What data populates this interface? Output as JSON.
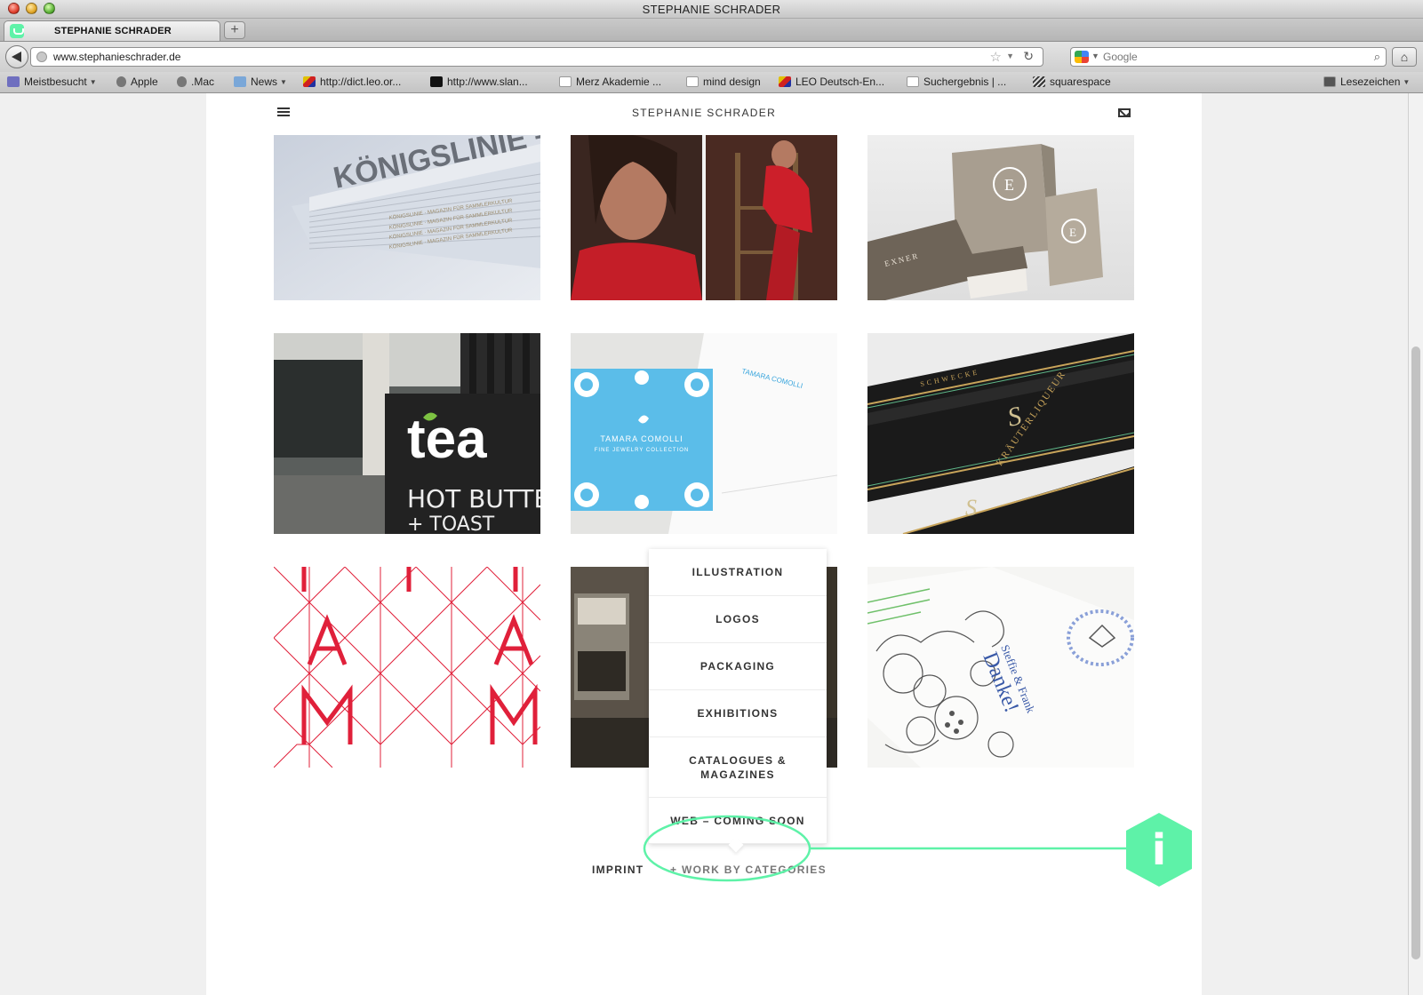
{
  "window": {
    "title": "STEPHANIE SCHRADER"
  },
  "tab": {
    "label": "STEPHANIE SCHRADER",
    "new_tab_symbol": "+"
  },
  "nav": {
    "url": "www.stephanieschrader.de",
    "search_placeholder": "Google"
  },
  "bookmarks": [
    {
      "label": "Meistbesucht",
      "icon": "star-icon",
      "dropdown": true
    },
    {
      "label": "Apple",
      "icon": "apple-icon",
      "dropdown": false
    },
    {
      "label": ".Mac",
      "icon": "apple-icon",
      "dropdown": false
    },
    {
      "label": "News",
      "icon": "folder-icon",
      "dropdown": true
    },
    {
      "label": "http://dict.leo.or...",
      "icon": "leo-icon",
      "dropdown": false
    },
    {
      "label": "http://www.slan...",
      "icon": "s-icon",
      "dropdown": false
    },
    {
      "label": "Merz Akademie ...",
      "icon": "page-icon",
      "dropdown": false
    },
    {
      "label": "mind design",
      "icon": "page-icon",
      "dropdown": false
    },
    {
      "label": "LEO Deutsch-En...",
      "icon": "leo-icon",
      "dropdown": false
    },
    {
      "label": "Suchergebnis | ...",
      "icon": "page-icon",
      "dropdown": false
    },
    {
      "label": "squarespace",
      "icon": "squarespace-icon",
      "dropdown": false
    },
    {
      "label": "Lesezeichen",
      "icon": "bookmarks-icon",
      "dropdown": true
    }
  ],
  "site": {
    "title": "STEPHANIE SCHRADER",
    "tiles": [
      {
        "name": "magazine-stack",
        "text": "KÖNIGSLINIE – MAGAZIN FÜR SAMMLERKULTUR"
      },
      {
        "name": "fashion-photo",
        "text": ""
      },
      {
        "name": "exner-branding",
        "text": "EXNER"
      },
      {
        "name": "tea-shop",
        "text": "tea",
        "sign_text": "HOT BUTTERE",
        "sign_text_2": "+ TOAST"
      },
      {
        "name": "tamara-comolli",
        "text": "TAMARA COMOLLI",
        "sub": "FINE JEWELRY COLLECTION"
      },
      {
        "name": "schwecke-labels",
        "text": "KRÄUTERLIQUEUR",
        "brand": "SCHWECKE"
      },
      {
        "name": "mama-pattern",
        "text": "A M"
      },
      {
        "name": "exhibition-room",
        "text": ""
      },
      {
        "name": "wedding-card",
        "text": "Danke!",
        "sub": "Steffie & Frank"
      }
    ],
    "categories": [
      "ILLUSTRATION",
      "LOGOS",
      "PACKAGING",
      "EXHIBITIONS",
      "CATALOGUES & MAGAZINES",
      "WEB – COMING SOON"
    ],
    "footer": {
      "imprint": "IMPRINT",
      "work_by_categories": "+ WORK BY CATEGORIES"
    }
  },
  "annotation": {
    "badge": "i",
    "color": "#5ef2a8"
  }
}
